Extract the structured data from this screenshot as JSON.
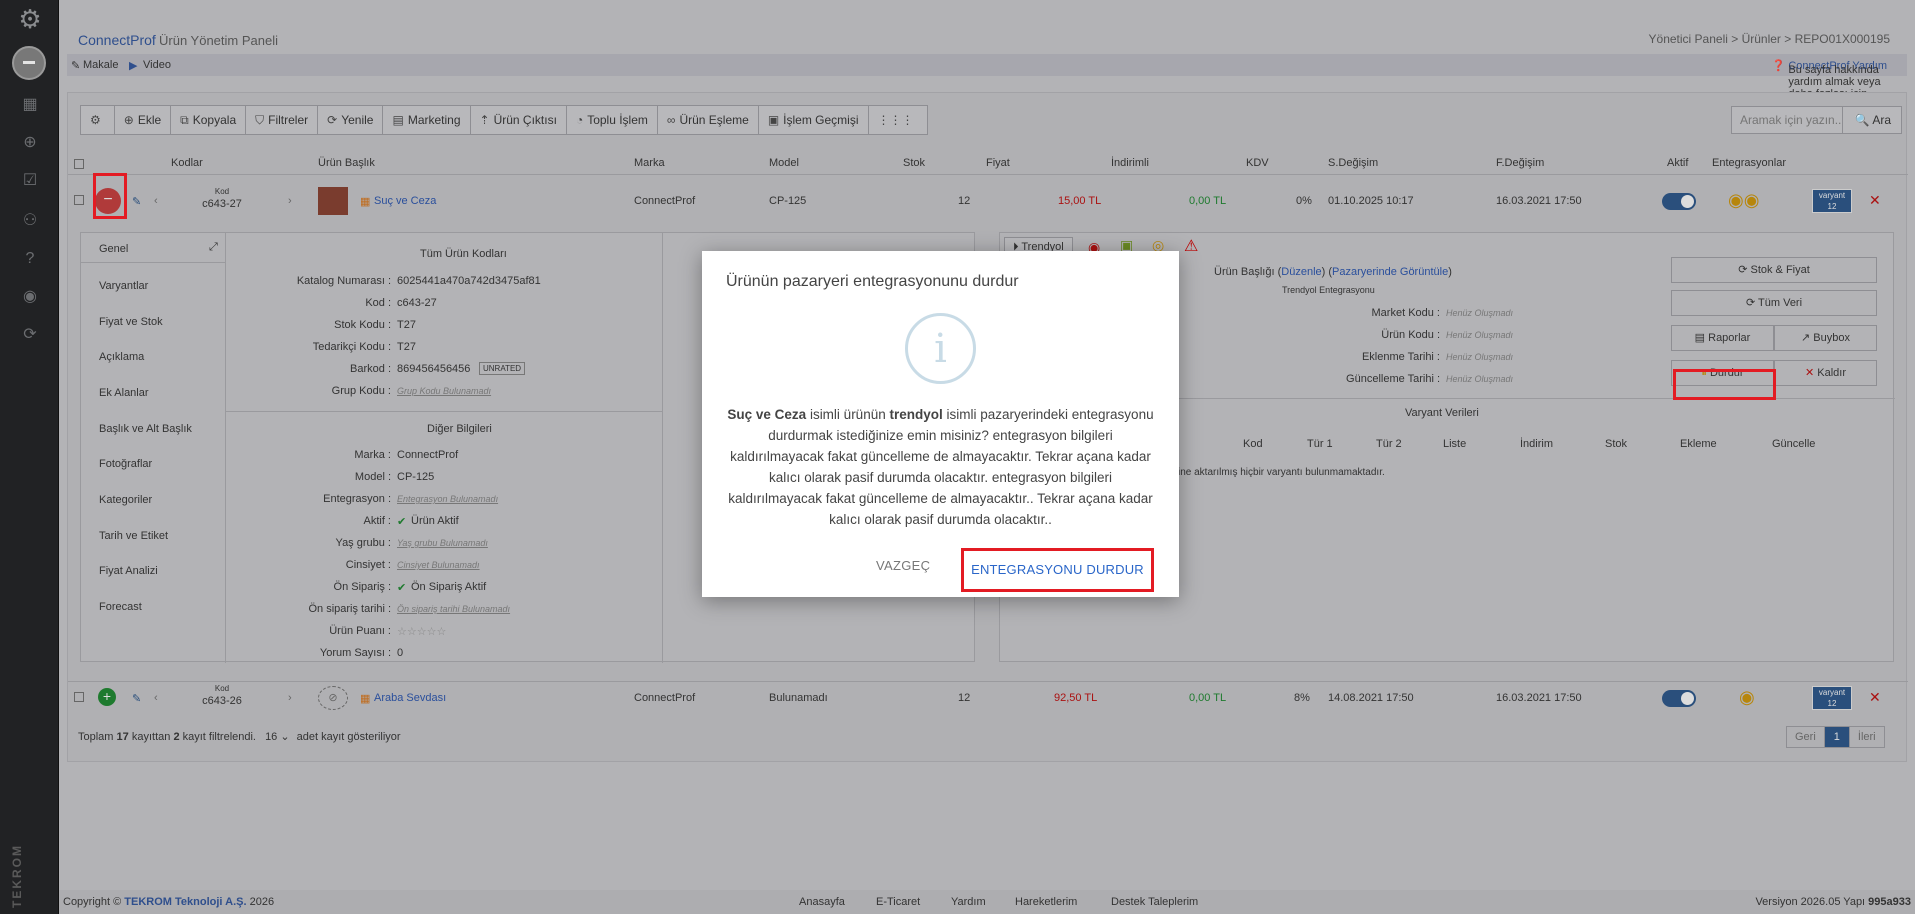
{
  "sidebar": {
    "icons": [
      "logo-icon",
      "dashboard-icon",
      "cart-icon",
      "checklist-icon",
      "users-icon",
      "help-icon",
      "fingerprint-icon",
      "sync-icon"
    ],
    "brand": "TEKROM"
  },
  "header": {
    "app": "ConnectProf",
    "subtitle": "Ürün Yönetim Paneli",
    "breadcrumb": "Yönetici Paneli  >  Ürünler  >  REPO01X000195"
  },
  "subbar": {
    "article": "Makale",
    "video": "Video",
    "help_text": "Bu sayfa hakkında yardım almak veya daha fazlası için",
    "help_link": "ConnectProf Yardım"
  },
  "toolbar": {
    "items": [
      "Ekle",
      "Kopyala",
      "Filtreler",
      "Yenile",
      "Marketing",
      "Ürün Çıktısı",
      "Toplu İşlem",
      "Ürün Eşleme",
      "İşlem Geçmişi"
    ],
    "search_placeholder": "Aramak için yazın...",
    "search_button": "Ara"
  },
  "table": {
    "headers": [
      "Kodlar",
      "Ürün Başlık",
      "Marka",
      "Model",
      "Stok",
      "Fiyat",
      "İndirimli",
      "KDV",
      "S.Değişim",
      "F.Değişim",
      "Aktif",
      "Entegrasyonlar"
    ],
    "rows": [
      {
        "code_label": "Kod",
        "code": "c643-27",
        "title": "Suç ve Ceza",
        "brand": "ConnectProf",
        "model": "CP-125",
        "stock": "12",
        "price": "15,00 TL",
        "discount": "0,00 TL",
        "kdv": "0%",
        "s_change": "01.10.2025 10:17",
        "f_change": "16.03.2021 17:50",
        "variant_label": "varyant",
        "variant_count": "12"
      },
      {
        "code_label": "Kod",
        "code": "c643-26",
        "title": "Araba Sevdası",
        "brand": "ConnectProf",
        "model": "Bulunamadı",
        "stock": "12",
        "price": "92,50 TL",
        "discount": "0,00 TL",
        "kdv": "8%",
        "s_change": "14.08.2021 17:50",
        "f_change": "16.03.2021 17:50",
        "variant_label": "varyant",
        "variant_count": "12"
      }
    ]
  },
  "detail": {
    "menu": [
      "Genel",
      "Varyantlar",
      "Fiyat ve Stok",
      "Açıklama",
      "Ek Alanlar",
      "Başlık ve Alt Başlık",
      "Fotoğraflar",
      "Kategoriler",
      "Tarih ve Etiket",
      "Fiyat Analizi",
      "Forecast"
    ],
    "codes_title": "Tüm Ürün Kodları",
    "codes": [
      [
        "Katalog Numarası :",
        "6025441a470a742d3475af81"
      ],
      [
        "Kod :",
        "c643-27"
      ],
      [
        "Stok Kodu :",
        "T27"
      ],
      [
        "Tedarikçi Kodu :",
        "T27"
      ],
      [
        "Barkod :",
        "869456456456"
      ],
      [
        "Grup Kodu :",
        "Grup Kodu Bulunamadı"
      ]
    ],
    "unrated": "UNRATED",
    "other_title": "Diğer Bilgileri",
    "other": [
      [
        "Marka :",
        "ConnectProf"
      ],
      [
        "Model :",
        "CP-125"
      ],
      [
        "Entegrasyon :",
        "Entegrasyon Bulunamadı"
      ],
      [
        "Aktif :",
        "Ürün Aktif"
      ],
      [
        "Yaş grubu :",
        "Yaş grubu Bulunamadı"
      ],
      [
        "Cinsiyet :",
        "Cinsiyet Bulunamadı"
      ],
      [
        "Ön Sipariş :",
        "Ön Sipariş Aktif"
      ],
      [
        "Ön sipariş tarihi :",
        "Ön sipariş tarihi Bulunamadı"
      ],
      [
        "Ürün Puanı :",
        "☆☆☆☆☆"
      ],
      [
        "Yorum Sayısı :",
        "0"
      ]
    ],
    "trendyol_tab": "Trendyol",
    "integration": {
      "title_label": "Ürün Başlığı",
      "edit": "Düzenle",
      "view": "Pazaryerinde Görüntüle",
      "sub": "Trendyol Entegrasyonu",
      "fields": [
        [
          "Market Kodu :",
          "Henüz Oluşmadı"
        ],
        [
          "Ürün Kodu :",
          "Henüz Oluşmadı"
        ],
        [
          "Eklenme Tarihi :",
          "Henüz Oluşmadı"
        ],
        [
          "Güncelleme Tarihi :",
          "Henüz Oluşmadı"
        ]
      ],
      "buttons": {
        "stock_price": "Stok & Fiyat",
        "all_data": "Tüm Veri",
        "reports": "Raporlar",
        "buybox": "Buybox",
        "pause": "Durdur",
        "remove": "Kaldır"
      },
      "variant_title": "Varyant Verileri",
      "variant_cols": [
        "Kod",
        "Tür 1",
        "Tür 2",
        "Liste",
        "İndirim",
        "Stok",
        "Ekleme",
        "Güncelle"
      ],
      "variant_empty": "ine aktarılmış hiçbir varyantı bulunmamaktadır."
    }
  },
  "pagination": {
    "summary_pre": "Toplam",
    "total": "17",
    "summary_mid": "kayıttan",
    "filtered": "2",
    "summary_post": "kayıt filtrelendi.",
    "per_page": "16",
    "per_page_suffix": "adet kayıt gösteriliyor",
    "prev": "Geri",
    "page": "1",
    "next": "İleri"
  },
  "footer": {
    "copyright": "Copyright © ",
    "company": "TEKROM Teknoloji A.Ş.",
    "year": " 2026",
    "links": [
      "Anasayfa",
      "E-Ticaret",
      "Yardım",
      "Hareketlerim",
      "Destek Taleplerim"
    ],
    "version": "Versiyon 2026.05 Yapı ",
    "build": "995a933"
  },
  "modal": {
    "title": "Ürünün pazaryeri entegrasyonunu durdur",
    "product": "Suç ve Ceza",
    "text1": " isimli ürünün ",
    "market": "trendyol",
    "text2": " isimli pazaryerindeki entegrasyonu durdurmak istediğinize emin misiniz? entegrasyon bilgileri kaldırılmayacak fakat güncelleme de almayacaktır. Tekrar açana kadar kalıcı olarak pasif durumda olacaktır. entegrasyon bilgileri kaldırılmayacak fakat güncelleme de almayacaktır.. Tekrar açana kadar kalıcı olarak pasif durumda olacaktır..",
    "cancel": "VAZGEÇ",
    "confirm": "ENTEGRASYONU DURDUR"
  }
}
